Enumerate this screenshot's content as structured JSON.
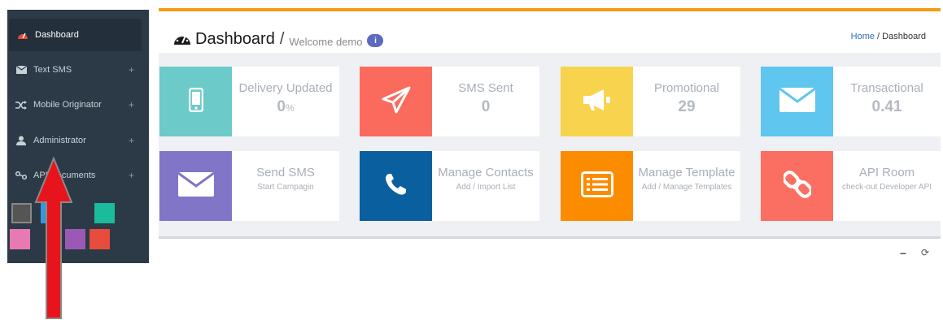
{
  "sidebar": {
    "items": [
      {
        "label": "Dashboard",
        "icon": "dashboard-gauge-icon",
        "active": true
      },
      {
        "label": "Text SMS",
        "icon": "envelope-icon",
        "plus": "+"
      },
      {
        "label": "Mobile Originator",
        "icon": "random-icon",
        "plus": "+"
      },
      {
        "label": "Administrator",
        "icon": "user-icon",
        "plus": "+"
      },
      {
        "label": "API Documents",
        "icon": "link-icon",
        "plus": "+"
      }
    ],
    "swatch_colors": [
      "#555555",
      "#3498db",
      "#1abc9c",
      "#e87ab3",
      "#9b59b6",
      "#e74c3c"
    ]
  },
  "header": {
    "title": "Dashboard",
    "slash": "/",
    "subtitle": "Welcome demo",
    "breadcrumb_home": "Home",
    "breadcrumb_sep": " / ",
    "breadcrumb_current": "Dashboard"
  },
  "stats": [
    {
      "label": "Delivery Updated",
      "value": "0",
      "unit": "%",
      "color": "#6ccac9",
      "icon": "mobile-phone-icon"
    },
    {
      "label": "SMS Sent",
      "value": "0",
      "color": "#fa6b5e",
      "icon": "paper-plane-icon"
    },
    {
      "label": "Promotional",
      "value": "29",
      "color": "#f8d34d",
      "icon": "megaphone-icon"
    },
    {
      "label": "Transactional",
      "value": "0.41",
      "color": "#5ec6ef",
      "icon": "envelope-icon"
    }
  ],
  "actions": [
    {
      "label": "Send SMS",
      "sub": "Start Campagin",
      "color": "#8175c7",
      "icon": "envelope-icon"
    },
    {
      "label": "Manage Contacts",
      "sub": "Add / Import List",
      "color": "#0a5f9e",
      "icon": "phone-icon"
    },
    {
      "label": "Manage Template",
      "sub": "Add / Manage Templates",
      "color": "#fb8c00",
      "icon": "list-alt-icon"
    },
    {
      "label": "API Room",
      "sub": "check-out Developer API",
      "color": "#fb6e62",
      "icon": "chain-link-icon"
    }
  ],
  "panel": {
    "minimize": "−",
    "refresh": "⟳"
  },
  "colors": {
    "accent": "#f39c12",
    "sidebar_bg": "#2c3a47",
    "arrow": "#e8141c"
  }
}
